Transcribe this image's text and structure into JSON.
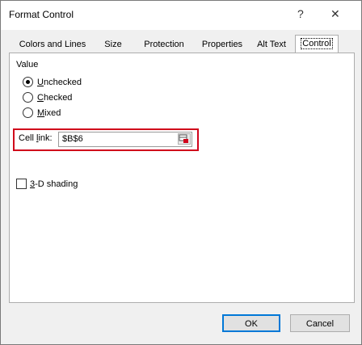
{
  "window": {
    "title": "Format Control",
    "help_glyph": "?",
    "close_glyph": "✕"
  },
  "tabs": [
    {
      "label": "Colors and Lines"
    },
    {
      "label": "Size"
    },
    {
      "label": "Protection"
    },
    {
      "label": "Properties"
    },
    {
      "label": "Alt Text"
    },
    {
      "label": "Control",
      "active": true
    }
  ],
  "value_section": {
    "label": "Value",
    "options": [
      {
        "pre": "",
        "key": "U",
        "post": "nchecked",
        "selected": true
      },
      {
        "pre": "",
        "key": "C",
        "post": "hecked",
        "selected": false
      },
      {
        "pre": "",
        "key": "M",
        "post": "ixed",
        "selected": false
      }
    ]
  },
  "cell_link": {
    "label_pre": "Cell ",
    "label_key": "l",
    "label_post": "ink:",
    "value": "$B$6"
  },
  "shading": {
    "key": "3",
    "post": "-D shading",
    "checked": false
  },
  "buttons": {
    "ok": "OK",
    "cancel": "Cancel"
  },
  "colors": {
    "highlight": "#d0021b",
    "accent": "#0078d7"
  },
  "icons": {
    "ref": "collapse-dialog-icon"
  }
}
